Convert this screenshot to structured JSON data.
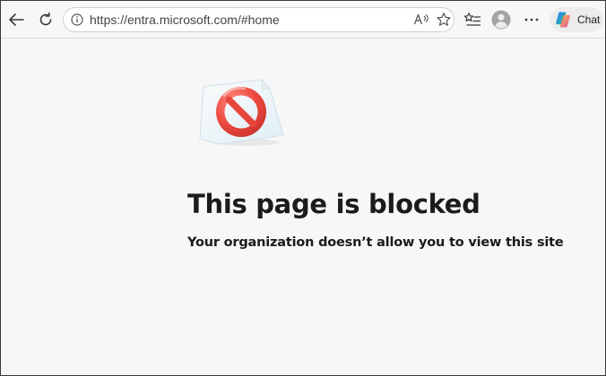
{
  "browser": {
    "url": "https://entra.microsoft.com/#home",
    "chat_label": "Chat",
    "accent_color": "#e8453c"
  },
  "icons": {
    "back": "arrow-left-icon",
    "refresh": "refresh-icon",
    "site_info": "info-icon",
    "read_aloud": "read-aloud-icon",
    "favorite": "star-icon",
    "favorites": "favorites-list-icon",
    "profile": "avatar-icon",
    "more": "ellipsis-icon",
    "copilot": "copilot-icon",
    "blocked": "no-entry-icon"
  },
  "blocked_page": {
    "title": "This page is blocked",
    "subtitle": "Your organization doesn’t allow you to view this site"
  }
}
